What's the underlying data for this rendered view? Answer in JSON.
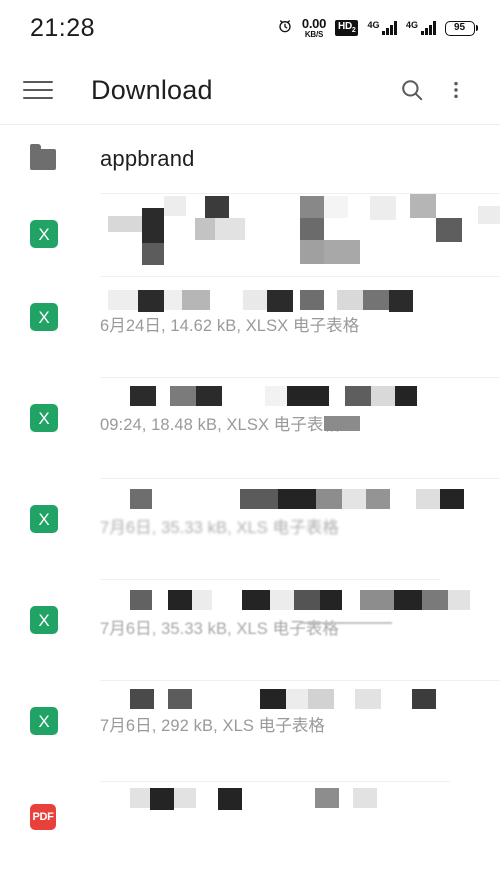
{
  "status_bar": {
    "time": "21:28",
    "alarm_icon": "alarm-clock-icon",
    "net_speed_value": "0.00",
    "net_speed_unit": "KB/S",
    "hd_badge": "HD",
    "hd_sub": "2",
    "sim1_network": "4G",
    "sim2_network": "4G",
    "battery_percent": "95"
  },
  "app_bar": {
    "menu_icon": "hamburger-menu-icon",
    "title": "Download",
    "search_icon": "search-icon",
    "overflow_icon": "more-options-icon"
  },
  "list": {
    "folder": {
      "icon": "folder-icon",
      "name": "appbrand"
    },
    "files": [
      {
        "icon": "xlsx-file-icon",
        "icon_label": "X",
        "file_type": "XLSX",
        "title": "",
        "subtitle": "",
        "title_redacted": true,
        "subtitle_redacted": true
      },
      {
        "icon": "xlsx-file-icon",
        "icon_label": "X",
        "file_type": "XLSX",
        "title": "",
        "subtitle": "6月24日, 14.62 kB, XLSX 电子表格",
        "title_redacted": true,
        "subtitle_redacted": false
      },
      {
        "icon": "xlsx-file-icon",
        "icon_label": "X",
        "file_type": "XLSX",
        "title": "",
        "subtitle": "09:24, 18.48 kB, XLSX 电子表格",
        "title_redacted": true,
        "subtitle_redacted": false
      },
      {
        "icon": "xls-file-icon",
        "icon_label": "X",
        "file_type": "XLS",
        "title": "",
        "subtitle": "7月6日, 35.33 kB, XLS 电子表格",
        "title_redacted": true,
        "subtitle_redacted": false
      },
      {
        "icon": "xls-file-icon",
        "icon_label": "X",
        "file_type": "XLS",
        "title": "",
        "subtitle": "7月6日, 35.33 kB, XLS 电子表格",
        "title_redacted": true,
        "subtitle_redacted": false
      },
      {
        "icon": "xls-file-icon",
        "icon_label": "X",
        "file_type": "XLS",
        "title": "",
        "subtitle": "7月6日, 292 kB, XLS 电子表格",
        "title_redacted": true,
        "subtitle_redacted": false
      },
      {
        "icon": "pdf-file-icon",
        "icon_label": "PDF",
        "file_type": "PDF",
        "title": "",
        "subtitle": "",
        "title_redacted": true,
        "subtitle_redacted": true
      }
    ]
  },
  "colors": {
    "background": "#ffffff",
    "excel_green": "#21a366",
    "pdf_red": "#e8403a",
    "folder_gray": "#6e6e6e",
    "title_text": "#1f1f1f",
    "subtitle_text": "#9a9a9a",
    "divider": "#f0f0f0"
  }
}
